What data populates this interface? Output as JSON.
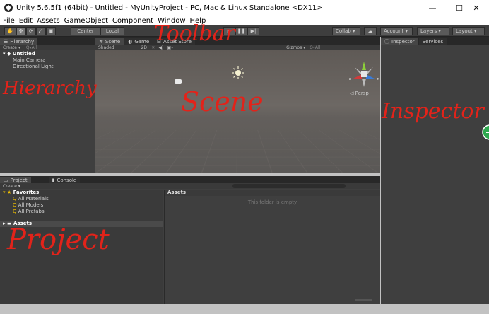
{
  "window": {
    "title": "Unity 5.6.5f1 (64bit) - Untitled - MyUnityProject - PC, Mac & Linux Standalone <DX11>",
    "controls": {
      "minimize": "—",
      "maximize": "☐",
      "close": "✕"
    }
  },
  "menu": [
    "File",
    "Edit",
    "Assets",
    "GameObject",
    "Component",
    "Window",
    "Help"
  ],
  "toolbar": {
    "tools": [
      "✋",
      "✥",
      "⟳",
      "⤢",
      "▣"
    ],
    "pivot": "Center",
    "space": "Local",
    "play": "▶",
    "pause": "❚❚",
    "step": "▶|",
    "collab": "Collab ▾",
    "cloud": "☁",
    "account": "Account ▾",
    "layers": "Layers ▾",
    "layout": "Layout ▾"
  },
  "hierarchy": {
    "tab": "Hierarchy",
    "create": "Create ▾",
    "search": "Q▾All",
    "scene": "Untitled",
    "items": [
      "Main Camera",
      "Directional Light"
    ]
  },
  "scene": {
    "tabs": [
      "Scene",
      "Game",
      "Asset Store"
    ],
    "shading": "Shaded",
    "mode": "2D",
    "gizmos": "Gizmos ▾",
    "gizmos_search": "Q▾All",
    "persp": "◁ Persp"
  },
  "inspector": {
    "tabs": [
      "Inspector",
      "Services"
    ]
  },
  "project": {
    "tabs": [
      "Project",
      "Console"
    ],
    "create": "Create ▾",
    "favorites": "Favorites",
    "fav_items": [
      "All Materials",
      "All Models",
      "All Prefabs"
    ],
    "assets": "Assets",
    "assets_header": "Assets",
    "empty_text": "This folder is empty"
  },
  "annotations": {
    "toolbar": "Toolbar",
    "hierarchy": "Hierarchy",
    "scene": "Scene",
    "inspector": "Inspector",
    "project": "Project",
    "color": "#e2231a"
  }
}
